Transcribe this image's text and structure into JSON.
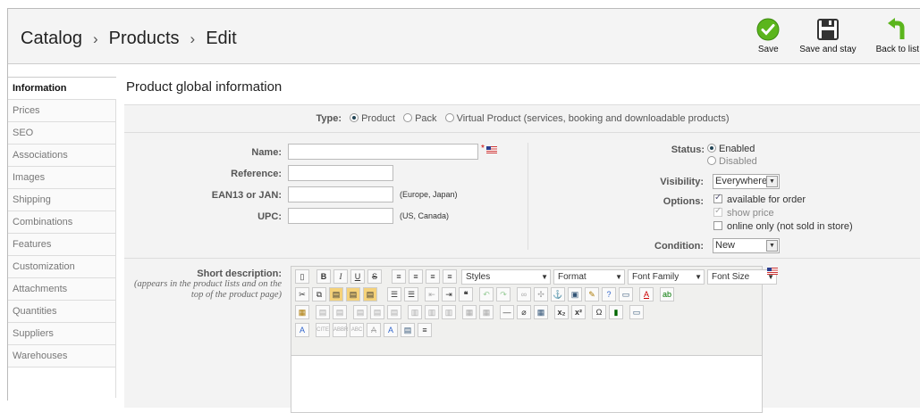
{
  "breadcrumb": {
    "items": [
      "Catalog",
      "Products",
      "Edit"
    ],
    "separator": "›"
  },
  "toolbar": {
    "save": "Save",
    "save_and_stay": "Save and stay",
    "back": "Back to list"
  },
  "sidebar": {
    "items": [
      "Information",
      "Prices",
      "SEO",
      "Associations",
      "Images",
      "Shipping",
      "Combinations",
      "Features",
      "Customization",
      "Attachments",
      "Quantities",
      "Suppliers",
      "Warehouses"
    ],
    "active": "Information"
  },
  "main": {
    "title": "Product global information"
  },
  "type": {
    "label": "Type:",
    "options": [
      "Product",
      "Pack",
      "Virtual Product (services, booking and downloadable products)"
    ],
    "selected": "Product"
  },
  "fields": {
    "name": {
      "label": "Name:",
      "value": "",
      "required_mark": "*"
    },
    "reference": {
      "label": "Reference:",
      "value": ""
    },
    "ean13": {
      "label": "EAN13 or JAN:",
      "value": "",
      "note": "(Europe, Japan)"
    },
    "upc": {
      "label": "UPC:",
      "value": "",
      "note": "(US, Canada)"
    }
  },
  "status": {
    "label": "Status:",
    "options": [
      "Enabled",
      "Disabled"
    ],
    "selected": "Enabled"
  },
  "visibility": {
    "label": "Visibility:",
    "value": "Everywhere"
  },
  "options": {
    "label": "Options:",
    "items": [
      "available for order",
      "show price",
      "online only (not sold in store)"
    ],
    "checked": [
      true,
      true,
      false
    ]
  },
  "condition": {
    "label": "Condition:",
    "value": "New"
  },
  "short_description": {
    "label": "Short description:",
    "hint": "(appears in the product lists and on the top of the product page)"
  },
  "editor": {
    "dropdowns": [
      "Styles",
      "Format",
      "Font Family",
      "Font Size"
    ]
  },
  "colors": {
    "accent_green": "#5bb51c",
    "header_bg": "#f4f4f4",
    "panel_bg": "#f3f3f3"
  }
}
